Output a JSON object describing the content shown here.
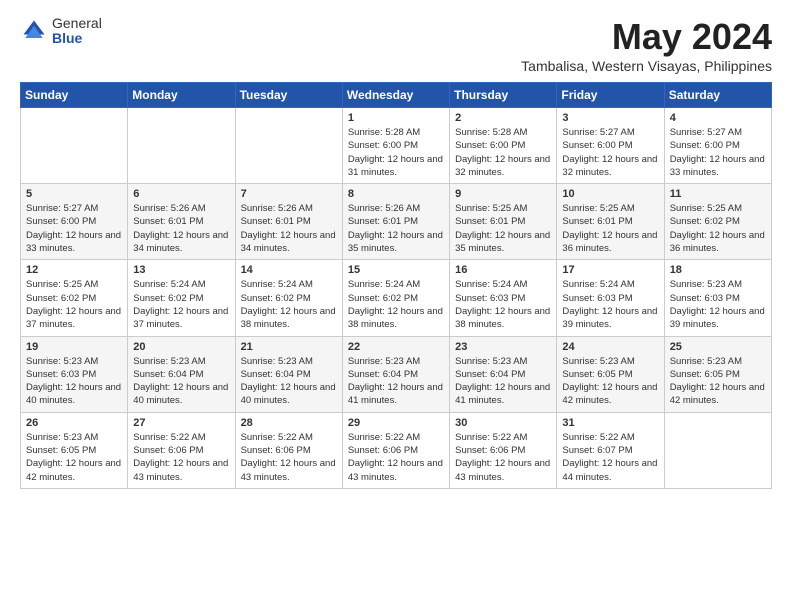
{
  "logo": {
    "general": "General",
    "blue": "Blue"
  },
  "title": "May 2024",
  "location": "Tambalisa, Western Visayas, Philippines",
  "weekdays": [
    "Sunday",
    "Monday",
    "Tuesday",
    "Wednesday",
    "Thursday",
    "Friday",
    "Saturday"
  ],
  "weeks": [
    [
      {
        "day": "",
        "info": ""
      },
      {
        "day": "",
        "info": ""
      },
      {
        "day": "",
        "info": ""
      },
      {
        "day": "1",
        "info": "Sunrise: 5:28 AM\nSunset: 6:00 PM\nDaylight: 12 hours\nand 31 minutes."
      },
      {
        "day": "2",
        "info": "Sunrise: 5:28 AM\nSunset: 6:00 PM\nDaylight: 12 hours\nand 32 minutes."
      },
      {
        "day": "3",
        "info": "Sunrise: 5:27 AM\nSunset: 6:00 PM\nDaylight: 12 hours\nand 32 minutes."
      },
      {
        "day": "4",
        "info": "Sunrise: 5:27 AM\nSunset: 6:00 PM\nDaylight: 12 hours\nand 33 minutes."
      }
    ],
    [
      {
        "day": "5",
        "info": "Sunrise: 5:27 AM\nSunset: 6:00 PM\nDaylight: 12 hours\nand 33 minutes."
      },
      {
        "day": "6",
        "info": "Sunrise: 5:26 AM\nSunset: 6:01 PM\nDaylight: 12 hours\nand 34 minutes."
      },
      {
        "day": "7",
        "info": "Sunrise: 5:26 AM\nSunset: 6:01 PM\nDaylight: 12 hours\nand 34 minutes."
      },
      {
        "day": "8",
        "info": "Sunrise: 5:26 AM\nSunset: 6:01 PM\nDaylight: 12 hours\nand 35 minutes."
      },
      {
        "day": "9",
        "info": "Sunrise: 5:25 AM\nSunset: 6:01 PM\nDaylight: 12 hours\nand 35 minutes."
      },
      {
        "day": "10",
        "info": "Sunrise: 5:25 AM\nSunset: 6:01 PM\nDaylight: 12 hours\nand 36 minutes."
      },
      {
        "day": "11",
        "info": "Sunrise: 5:25 AM\nSunset: 6:02 PM\nDaylight: 12 hours\nand 36 minutes."
      }
    ],
    [
      {
        "day": "12",
        "info": "Sunrise: 5:25 AM\nSunset: 6:02 PM\nDaylight: 12 hours\nand 37 minutes."
      },
      {
        "day": "13",
        "info": "Sunrise: 5:24 AM\nSunset: 6:02 PM\nDaylight: 12 hours\nand 37 minutes."
      },
      {
        "day": "14",
        "info": "Sunrise: 5:24 AM\nSunset: 6:02 PM\nDaylight: 12 hours\nand 38 minutes."
      },
      {
        "day": "15",
        "info": "Sunrise: 5:24 AM\nSunset: 6:02 PM\nDaylight: 12 hours\nand 38 minutes."
      },
      {
        "day": "16",
        "info": "Sunrise: 5:24 AM\nSunset: 6:03 PM\nDaylight: 12 hours\nand 38 minutes."
      },
      {
        "day": "17",
        "info": "Sunrise: 5:24 AM\nSunset: 6:03 PM\nDaylight: 12 hours\nand 39 minutes."
      },
      {
        "day": "18",
        "info": "Sunrise: 5:23 AM\nSunset: 6:03 PM\nDaylight: 12 hours\nand 39 minutes."
      }
    ],
    [
      {
        "day": "19",
        "info": "Sunrise: 5:23 AM\nSunset: 6:03 PM\nDaylight: 12 hours\nand 40 minutes."
      },
      {
        "day": "20",
        "info": "Sunrise: 5:23 AM\nSunset: 6:04 PM\nDaylight: 12 hours\nand 40 minutes."
      },
      {
        "day": "21",
        "info": "Sunrise: 5:23 AM\nSunset: 6:04 PM\nDaylight: 12 hours\nand 40 minutes."
      },
      {
        "day": "22",
        "info": "Sunrise: 5:23 AM\nSunset: 6:04 PM\nDaylight: 12 hours\nand 41 minutes."
      },
      {
        "day": "23",
        "info": "Sunrise: 5:23 AM\nSunset: 6:04 PM\nDaylight: 12 hours\nand 41 minutes."
      },
      {
        "day": "24",
        "info": "Sunrise: 5:23 AM\nSunset: 6:05 PM\nDaylight: 12 hours\nand 42 minutes."
      },
      {
        "day": "25",
        "info": "Sunrise: 5:23 AM\nSunset: 6:05 PM\nDaylight: 12 hours\nand 42 minutes."
      }
    ],
    [
      {
        "day": "26",
        "info": "Sunrise: 5:23 AM\nSunset: 6:05 PM\nDaylight: 12 hours\nand 42 minutes."
      },
      {
        "day": "27",
        "info": "Sunrise: 5:22 AM\nSunset: 6:06 PM\nDaylight: 12 hours\nand 43 minutes."
      },
      {
        "day": "28",
        "info": "Sunrise: 5:22 AM\nSunset: 6:06 PM\nDaylight: 12 hours\nand 43 minutes."
      },
      {
        "day": "29",
        "info": "Sunrise: 5:22 AM\nSunset: 6:06 PM\nDaylight: 12 hours\nand 43 minutes."
      },
      {
        "day": "30",
        "info": "Sunrise: 5:22 AM\nSunset: 6:06 PM\nDaylight: 12 hours\nand 43 minutes."
      },
      {
        "day": "31",
        "info": "Sunrise: 5:22 AM\nSunset: 6:07 PM\nDaylight: 12 hours\nand 44 minutes."
      },
      {
        "day": "",
        "info": ""
      }
    ]
  ]
}
